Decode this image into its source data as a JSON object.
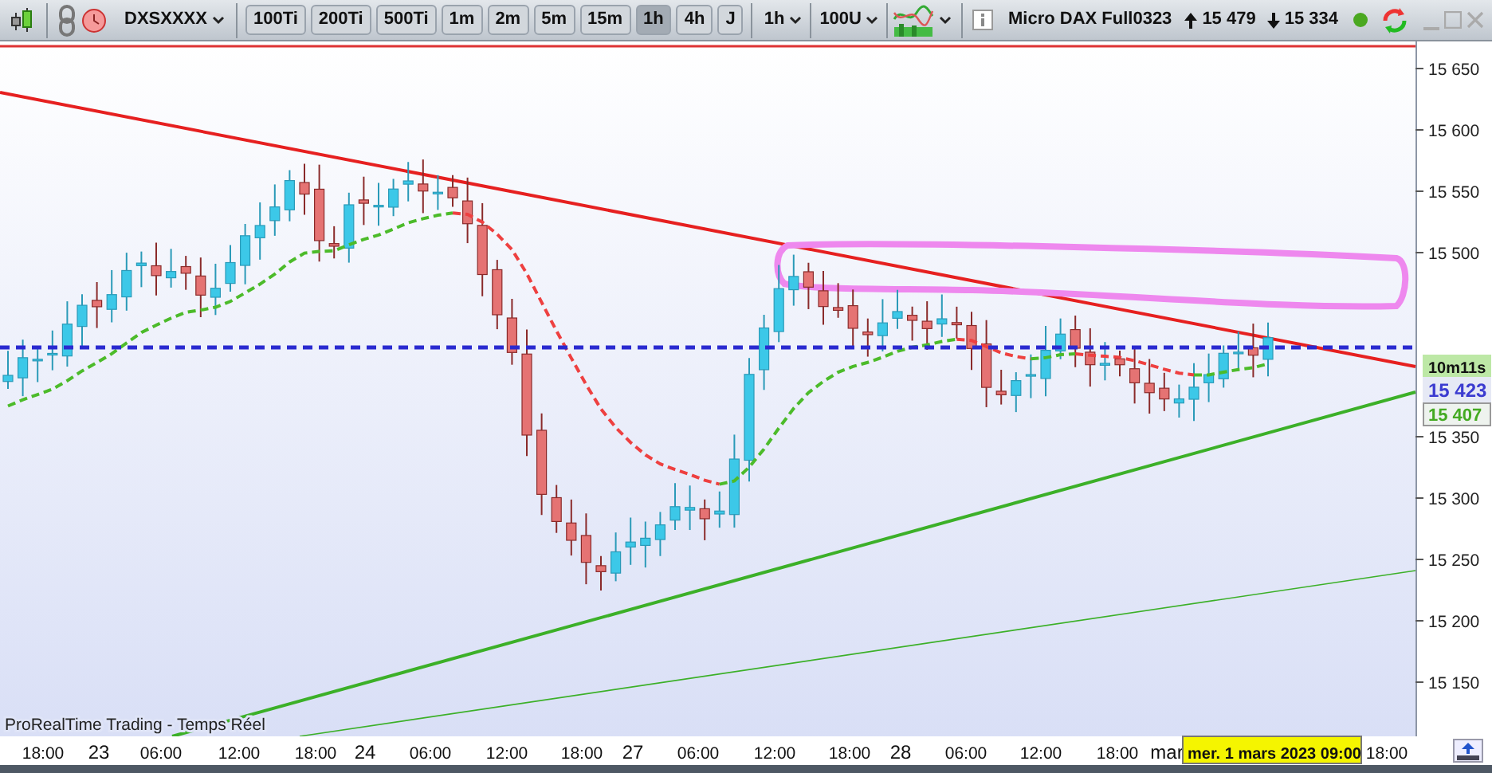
{
  "toolbar": {
    "symbol": "DXSXXXX",
    "intervals": [
      {
        "label": "100Ti",
        "selected": false
      },
      {
        "label": "200Ti",
        "selected": false
      },
      {
        "label": "500Ti",
        "selected": false
      },
      {
        "label": "1m",
        "selected": false
      },
      {
        "label": "2m",
        "selected": false
      },
      {
        "label": "5m",
        "selected": false
      },
      {
        "label": "15m",
        "selected": false
      },
      {
        "label": "1h",
        "selected": true
      },
      {
        "label": "4h",
        "selected": false
      },
      {
        "label": "J",
        "selected": false
      }
    ],
    "period_select": "1h",
    "units_select": "100U",
    "instrument": "Micro DAX Full0323",
    "high": "15 479",
    "low": "15 334",
    "live": true
  },
  "chart": {
    "source_label": "ProRealTime Trading - Temps Réel",
    "price_ticks": [
      "15 650",
      "15 600",
      "15 550",
      "15 500",
      "15 350",
      "15 300",
      "15 250",
      "15 200",
      "15 150"
    ],
    "markers": [
      {
        "kind": "countdown",
        "text": "10m11s"
      },
      {
        "kind": "last",
        "text": "15 423"
      },
      {
        "kind": "average",
        "text": "15 407"
      }
    ],
    "time_labels": [
      {
        "text": "18:00",
        "kind": "time"
      },
      {
        "text": "23",
        "kind": "day"
      },
      {
        "text": "06:00",
        "kind": "time"
      },
      {
        "text": "12:00",
        "kind": "time"
      },
      {
        "text": "18:00",
        "kind": "time"
      },
      {
        "text": "24",
        "kind": "day"
      },
      {
        "text": "06:00",
        "kind": "time"
      },
      {
        "text": "12:00",
        "kind": "time"
      },
      {
        "text": "18:00",
        "kind": "time"
      },
      {
        "text": "27",
        "kind": "day"
      },
      {
        "text": "06:00",
        "kind": "time"
      },
      {
        "text": "12:00",
        "kind": "time"
      },
      {
        "text": "18:00",
        "kind": "time"
      },
      {
        "text": "28",
        "kind": "day"
      },
      {
        "text": "06:00",
        "kind": "time"
      },
      {
        "text": "12:00",
        "kind": "time"
      },
      {
        "text": "18:00",
        "kind": "time"
      },
      {
        "text": "mar",
        "kind": "day"
      },
      {
        "text": "18:00",
        "kind": "time"
      }
    ],
    "cursor_label": "mer. 1 mars 2023 09:00"
  }
}
